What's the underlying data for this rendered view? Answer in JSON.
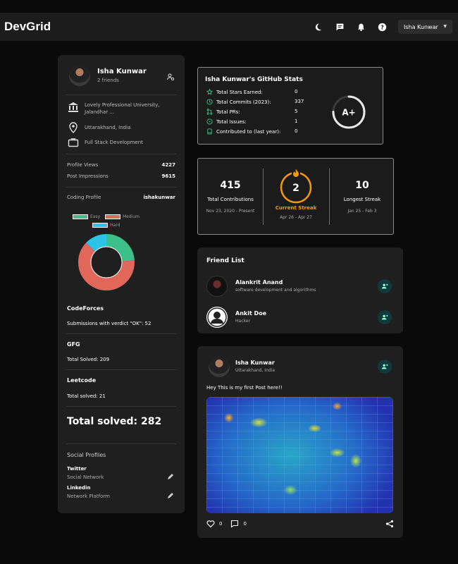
{
  "topbar": {
    "brand": "DevGrid",
    "user": "Isha Kunwar",
    "icons": [
      "moon-icon",
      "chat-icon",
      "bell-icon",
      "help-icon",
      "chevron-down-icon"
    ]
  },
  "profile": {
    "name": "Isha Kunwar",
    "friends": "2 friends",
    "university": "Lovely Professional University, Jalandhar ...",
    "location": "Uttarakhand, India",
    "role": "Full Stack Development",
    "profile_views_label": "Profile Views",
    "profile_views": "4227",
    "post_impressions_label": "Post Impressions",
    "post_impressions": "9615",
    "coding_profile_label": "Coding Profile",
    "coding_handle": "ishakunwar",
    "legend": {
      "easy": "Easy",
      "medium": "Medium",
      "hard": "Hard"
    },
    "legend_colors": {
      "easy": "#3dbf8a",
      "medium": "#e0675a",
      "hard": "#2bc4e8"
    },
    "donut_shares": {
      "easy": 0.24,
      "medium": 0.63,
      "hard": 0.13
    },
    "codeforces_title": "CodeForces",
    "codeforces_text": "Submissions with verdict \"OK\": 52",
    "gfg_title": "GFG",
    "gfg_text": "Total Solved: 209",
    "leetcode_title": "Leetcode",
    "leetcode_text": "Total solved: 21",
    "total_solved": "Total solved: 282",
    "social_title": "Social Profiles",
    "socials": [
      {
        "name": "Twitter",
        "type": "Social Network"
      },
      {
        "name": "Linkedin",
        "type": "Network Platform"
      }
    ]
  },
  "github": {
    "title": "Isha Kunwar's GitHub Stats",
    "rows": [
      {
        "label": "Total Stars Earned:",
        "value": "0"
      },
      {
        "label": "Total Commits (2023):",
        "value": "337"
      },
      {
        "label": "Total PRs:",
        "value": "5"
      },
      {
        "label": "Total Issues:",
        "value": "1"
      },
      {
        "label": "Contributed to (last year):",
        "value": "0"
      }
    ],
    "grade": "A+",
    "accent": "#3dbf8a"
  },
  "streak": {
    "total": "415",
    "total_label": "Total Contributions",
    "total_range": "Nov 23, 2020 - Present",
    "current": "2",
    "current_label": "Current Streak",
    "current_range": "Apr 26 - Apr 27",
    "longest": "10",
    "longest_label": "Longest Streak",
    "longest_range": "Jan 25 - Feb 3",
    "accent": "#f29b0e"
  },
  "friends": {
    "title": "Friend List",
    "items": [
      {
        "name": "Alankrit Anand",
        "sub": "software development and algorithms"
      },
      {
        "name": "Ankit Doe",
        "sub": "Hacker"
      }
    ]
  },
  "post": {
    "author": "Isha Kunwar",
    "location": "Uttarakhand, India",
    "text": "Hey This is my first Post here!!",
    "likes": "0",
    "comments": "0"
  }
}
